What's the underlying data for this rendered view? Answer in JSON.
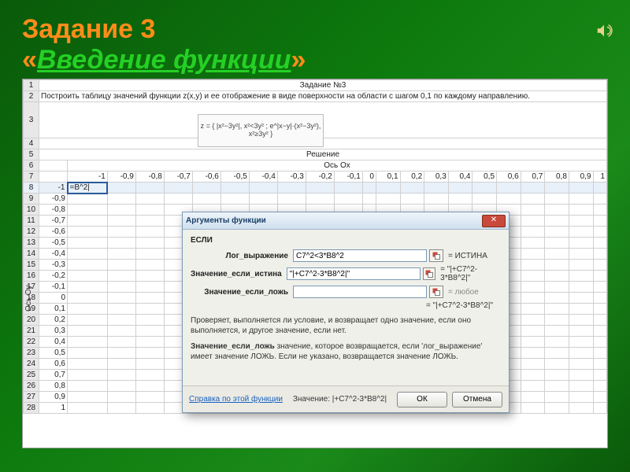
{
  "slide": {
    "title_part1": "Задание 3",
    "title_part2": "Введение функции"
  },
  "sheet": {
    "task_header": "Задание №3",
    "task_text": "Построить таблицу значений функции z(x,y) и ее отображение в виде поверхности на области с шагом 0,1 по каждому направлению.",
    "formula_caption": "z = { |x²−3y²|, x²<3y² ; e^|x−y|·(x²−3y²), x²≥3y² }",
    "solution_label": "Решение",
    "axis_ox": "Ось Ox",
    "axis_oy": "Ось Оу",
    "x_values": [
      "-1",
      "-0,9",
      "-0,8",
      "-0,7",
      "-0,6",
      "-0,5",
      "-0,4",
      "-0,3",
      "-0,2",
      "-0,1",
      "0",
      "0,1",
      "0,2",
      "0,3",
      "0,4",
      "0,5",
      "0,6",
      "0,7",
      "0,8",
      "0,9",
      "1"
    ],
    "y_values": [
      "-0,9",
      "-0,8",
      "-0,7",
      "-0,6",
      "-0,5",
      "-0,4",
      "-0,3",
      "-0,2",
      "-0,1",
      "0",
      "0,1",
      "0,2",
      "0,3",
      "0,4",
      "0,5",
      "0,6",
      "0,7",
      "0,8",
      "0,9",
      "1"
    ],
    "selected_cell_formula": "=B^2|",
    "selected_row_header_value": "-1"
  },
  "dialog": {
    "title": "Аргументы функции",
    "func": "ЕСЛИ",
    "args": [
      {
        "label": "Лог_выражение",
        "value": "C7^2<3*B8^2",
        "result": "= ИСТИНА"
      },
      {
        "label": "Значение_если_истина",
        "value": "\"|+C7^2-3*B8^2|\"",
        "result": "= \"|+C7^2-3*B8^2|\""
      },
      {
        "label": "Значение_если_ложь",
        "value": "",
        "result": "= любое"
      }
    ],
    "overall_result": "= \"|+C7^2-3*B8^2|\"",
    "desc1": "Проверяет, выполняется ли условие, и возвращает одно значение, если оно выполняется, и другое значение, если нет.",
    "desc2_bold": "Значение_если_ложь",
    "desc2_rest": "значение, которое возвращается, если 'лог_выражение' имеет значение ЛОЖЬ. Если не указано, возвращается значение ЛОЖЬ.",
    "help_link": "Справка по этой функции",
    "value_label": "Значение:",
    "value": "|+C7^2-3*B8^2|",
    "ok": "ОК",
    "cancel": "Отмена"
  }
}
